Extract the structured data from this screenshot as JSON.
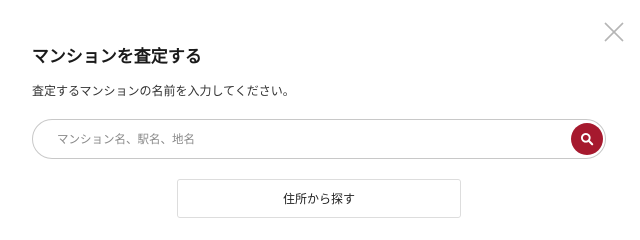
{
  "modal": {
    "title": "マンションを査定する",
    "instruction": "査定するマンションの名前を入力してください。",
    "close_icon": "close-icon"
  },
  "search": {
    "placeholder": "マンション名、駅名、地名",
    "value": "",
    "button_icon": "search-icon",
    "button_color": "#a6192e"
  },
  "address_search": {
    "label": "住所から探す"
  }
}
